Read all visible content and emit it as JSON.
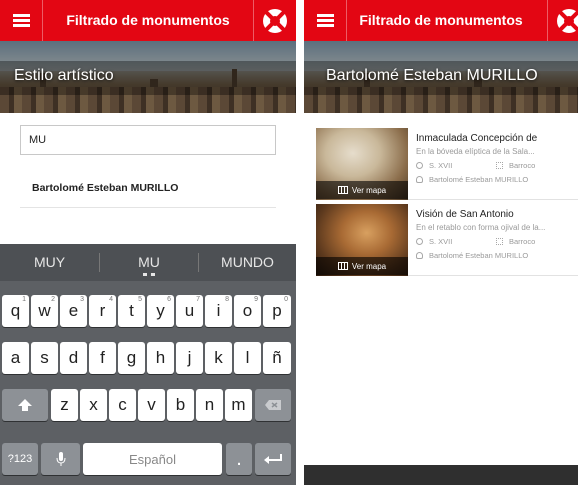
{
  "left_screen": {
    "header": {
      "title": "Filtrado de monumentos",
      "menu_icon": "hamburger-icon",
      "help_icon": "lifebuoy-icon"
    },
    "banner_label": "Estilo artístico",
    "search": {
      "value": "MU",
      "placeholder": ""
    },
    "suggestions": [
      {
        "label": "Bartolomé Esteban MURILLO"
      }
    ],
    "keyboard": {
      "word_suggestions": [
        "MUY",
        "MU",
        "MUNDO"
      ],
      "rows": [
        [
          {
            "label": "q",
            "hint": "1"
          },
          {
            "label": "w",
            "hint": "2"
          },
          {
            "label": "e",
            "hint": "3"
          },
          {
            "label": "r",
            "hint": "4"
          },
          {
            "label": "t",
            "hint": "5"
          },
          {
            "label": "y",
            "hint": "6"
          },
          {
            "label": "u",
            "hint": "7"
          },
          {
            "label": "i",
            "hint": "8"
          },
          {
            "label": "o",
            "hint": "9"
          },
          {
            "label": "p",
            "hint": "0"
          }
        ],
        [
          {
            "label": "a"
          },
          {
            "label": "s"
          },
          {
            "label": "d"
          },
          {
            "label": "f"
          },
          {
            "label": "g"
          },
          {
            "label": "h"
          },
          {
            "label": "j"
          },
          {
            "label": "k"
          },
          {
            "label": "l"
          },
          {
            "label": "ñ"
          }
        ],
        [
          {
            "label": "z"
          },
          {
            "label": "x"
          },
          {
            "label": "c"
          },
          {
            "label": "v"
          },
          {
            "label": "b"
          },
          {
            "label": "n"
          },
          {
            "label": "m"
          }
        ]
      ],
      "shift_icon": "shift-arrow-icon",
      "backspace_icon": "backspace-icon",
      "symbols_label": "?123",
      "mic_icon": "microphone-icon",
      "space_label": "Español",
      "period_label": ".",
      "enter_icon": "enter-arrow-icon"
    }
  },
  "right_screen": {
    "header": {
      "title": "Filtrado de monumentos",
      "menu_icon": "hamburger-icon",
      "help_icon": "lifebuoy-icon"
    },
    "banner_label": "Bartolomé Esteban MURILLO",
    "results": [
      {
        "name": "Inmaculada Concepción de",
        "description": "En la bóveda elíptica de la Sala...",
        "century": "S. XVII",
        "style": "Barroco",
        "artist": "Bartolomé Esteban MURILLO",
        "map_label": "Ver mapa"
      },
      {
        "name": "Visión de San Antonio",
        "description": "En el retablo con forma ojival de la...",
        "century": "S. XVII",
        "style": "Barroco",
        "artist": "Bartolomé Esteban MURILLO",
        "map_label": "Ver mapa"
      }
    ]
  },
  "colors": {
    "accent": "#e30613",
    "keyboard_bg": "#5d6064",
    "muted_text": "#9a9a9a"
  }
}
